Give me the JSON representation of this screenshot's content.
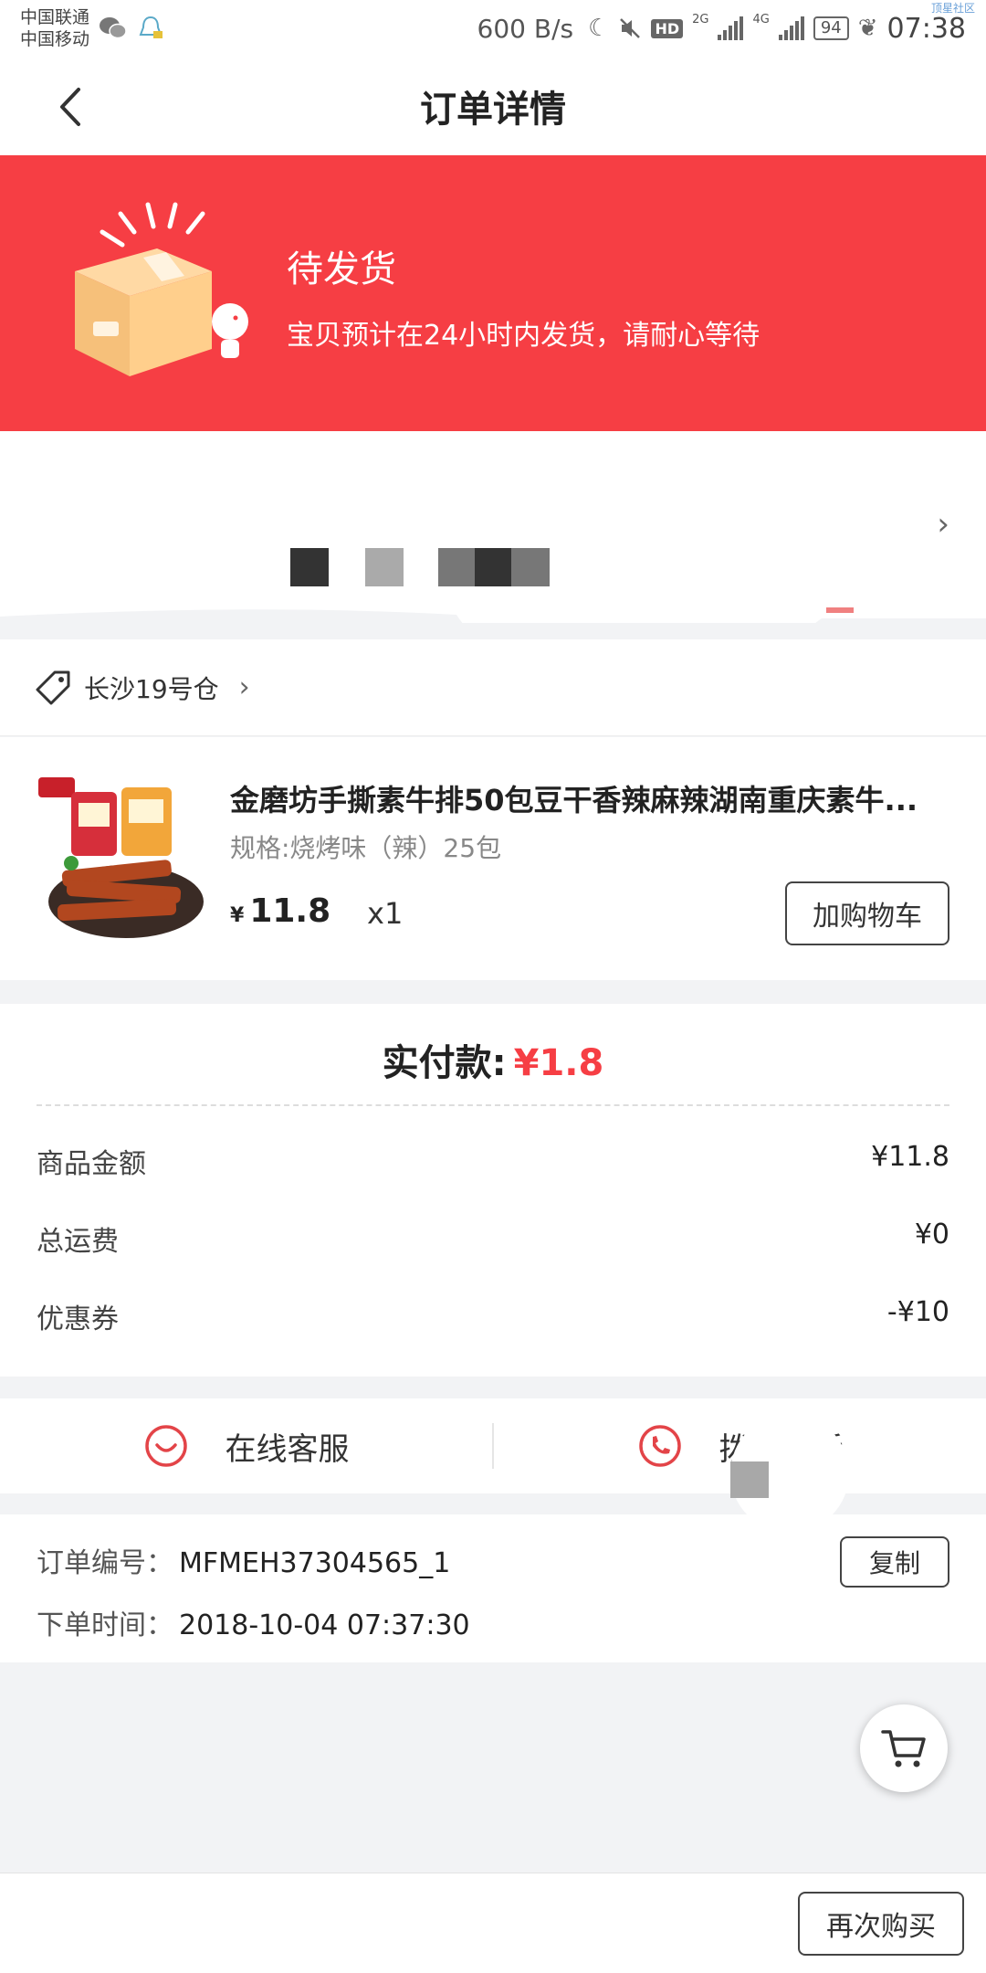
{
  "status_bar": {
    "carrier1": "中国联通",
    "carrier2": "中国移动",
    "speed": "600 B/s",
    "hd": "HD",
    "net1": "2G",
    "net2": "4G",
    "battery": "94",
    "time": "07:38",
    "corner_tag": "顶星社区"
  },
  "header": {
    "title": "订单详情"
  },
  "banner": {
    "title": "待发货",
    "subtitle": "宝贝预计在24小时内发货，请耐心等待",
    "color": "#f63e44"
  },
  "warehouse": {
    "label": "长沙19号仓"
  },
  "product": {
    "name": "金磨坊手撕素牛排50包豆干香辣麻辣湖南重庆素牛...",
    "spec": "规格:烧烤味（辣）25包",
    "currency": "¥",
    "price": "11.8",
    "qty": "x1",
    "add_cart_label": "加购物车"
  },
  "payment": {
    "paid_label": "实付款:",
    "paid_amount": "¥1.8",
    "rows": [
      {
        "label": "商品金额",
        "value": "¥11.8"
      },
      {
        "label": "总运费",
        "value": "¥0"
      },
      {
        "label": "优惠券",
        "value": "-¥10"
      }
    ]
  },
  "service": {
    "online_label": "在线客服",
    "phone_label": "拨打电话"
  },
  "order_info": {
    "no_label": "订单编号：",
    "no_value": "MFMEH37304565_1",
    "time_label": "下单时间：",
    "time_value": "2018-10-04 07:37:30",
    "copy_label": "复制"
  },
  "bottom": {
    "rebuy_label": "再次购买"
  }
}
